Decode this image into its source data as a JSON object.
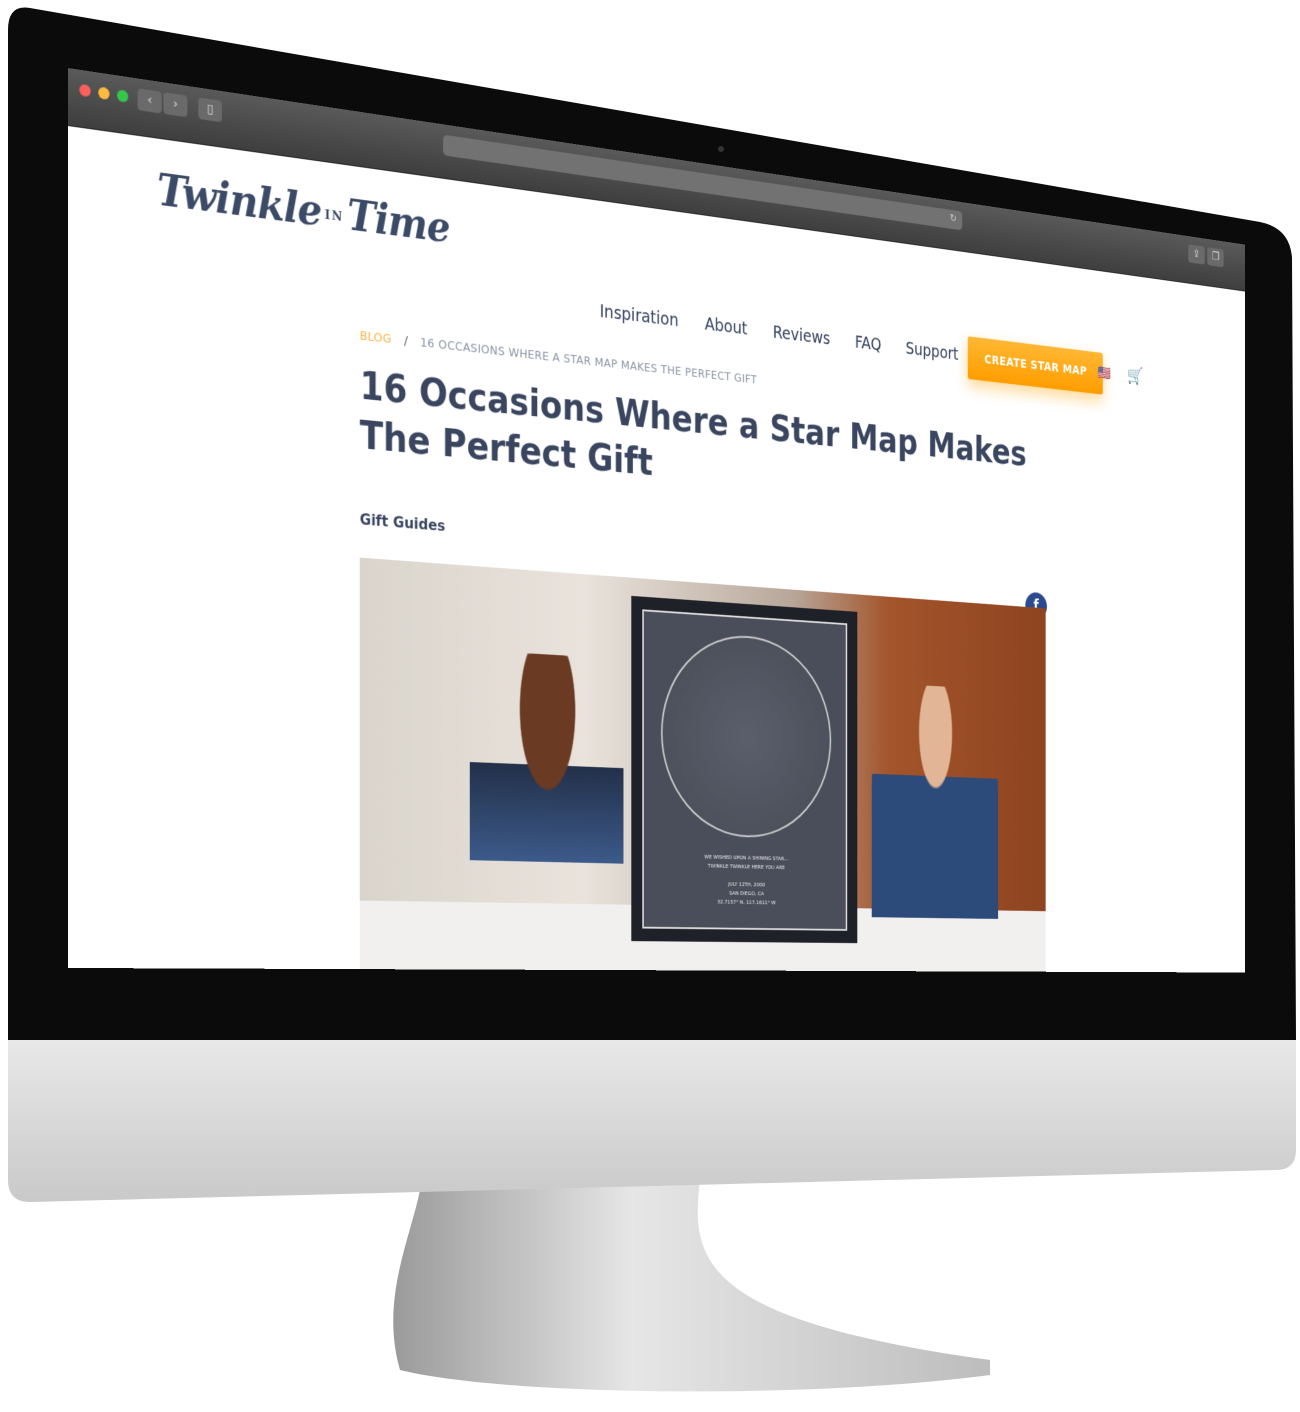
{
  "browser": {
    "back_icon": "chevron-left-icon",
    "forward_icon": "chevron-right-icon",
    "sidebar_icon": "sidebar-icon",
    "reload_icon": "reload-icon",
    "share_icon": "share-icon",
    "tabs_icon": "tabs-icon"
  },
  "site": {
    "logo_main": "Twinkle",
    "logo_in": "IN",
    "logo_end": "Time",
    "nav": [
      {
        "label": "Inspiration"
      },
      {
        "label": "About"
      },
      {
        "label": "Reviews"
      },
      {
        "label": "FAQ"
      },
      {
        "label": "Support"
      }
    ],
    "cta": "CREATE STAR MAP",
    "flag_icon": "us-flag-icon",
    "cart_icon": "cart-icon",
    "accent": "#ff9d00"
  },
  "article": {
    "breadcrumb": {
      "root": "BLOG",
      "sep": "/",
      "current": "16 OCCASIONS WHERE A STAR MAP MAKES THE PERFECT GIFT"
    },
    "title": "16 Occasions Where a Star Map Makes The Perfect Gift",
    "category": "Gift Guides",
    "share": "f",
    "poster": {
      "line1": "WE WISHED UPON A SHINING STAR...",
      "line2": "TWINKLE TWINKLE HERE YOU ARE",
      "date": "JULY 12TH, 2000",
      "place": "SAN DIEGO, CA",
      "coords": "32.7157° N, 117.1611° W"
    }
  }
}
